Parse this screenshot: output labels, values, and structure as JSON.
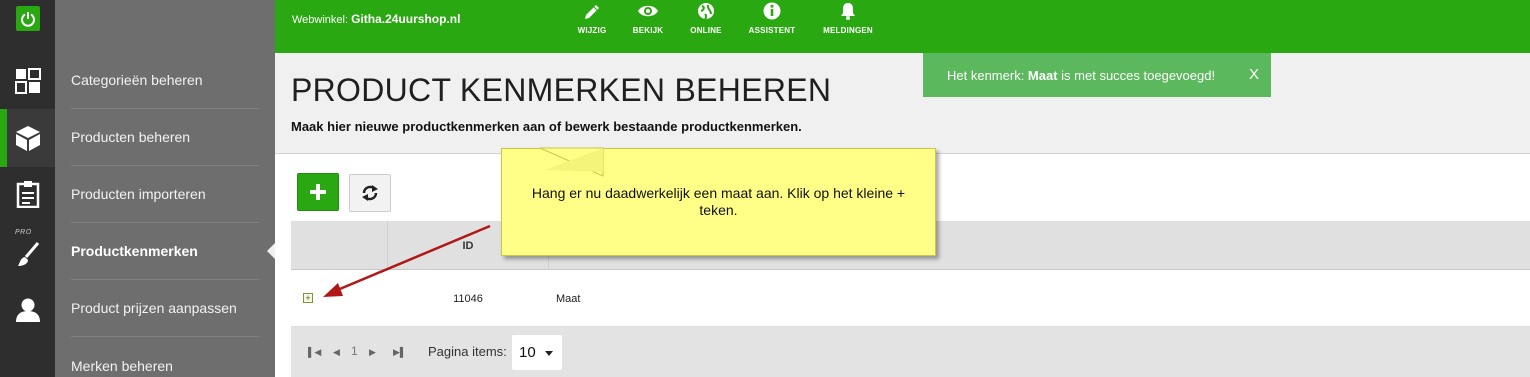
{
  "topbar": {
    "shop_prefix": "Webwinkel:",
    "shop_name": "Githa.24uurshop.nl",
    "actions": [
      {
        "label": "WIJZIG",
        "icon": "pencil-icon"
      },
      {
        "label": "BEKIJK",
        "icon": "eye-icon"
      },
      {
        "label": "ONLINE",
        "icon": "globe-icon"
      },
      {
        "label": "ASSISTENT",
        "icon": "info-icon"
      },
      {
        "label": "MELDINGEN",
        "icon": "bell-icon"
      }
    ]
  },
  "rail": {
    "pro_label": "PRO",
    "icons": [
      "power-icon",
      "dashboard-icon",
      "box-icon",
      "clipboard-icon",
      "brush-icon",
      "user-icon"
    ]
  },
  "menu": {
    "items": [
      {
        "label": "Categorieën beheren"
      },
      {
        "label": "Producten beheren"
      },
      {
        "label": "Producten importeren"
      },
      {
        "label": "Productkenmerken",
        "active": true
      },
      {
        "label": "Product prijzen aanpassen"
      },
      {
        "label": "Merken beheren"
      }
    ]
  },
  "notice": {
    "prefix": "Het kenmerk: ",
    "name": "Maat",
    "suffix": " is met succes toegevoegd!",
    "close": "X"
  },
  "page": {
    "title": "PRODUCT KENMERKEN BEHEREN",
    "subtitle": "Maak hier nieuwe productkenmerken aan of bewerk bestaande productkenmerken."
  },
  "grid": {
    "columns": [
      "",
      "ID",
      ""
    ],
    "rows": [
      {
        "id": "11046",
        "name": "Maat"
      }
    ]
  },
  "pager": {
    "page": "1",
    "items_label": "Pagina items:",
    "items_value": "10"
  },
  "tooltip": {
    "text": "Hang er nu daadwerkelijk een maat aan. Klik op het kleine + teken."
  },
  "colors": {
    "brand": "#2aa812",
    "notice": "#5cb85c",
    "tooltip": "#ffff88",
    "arrow": "#b01818"
  }
}
